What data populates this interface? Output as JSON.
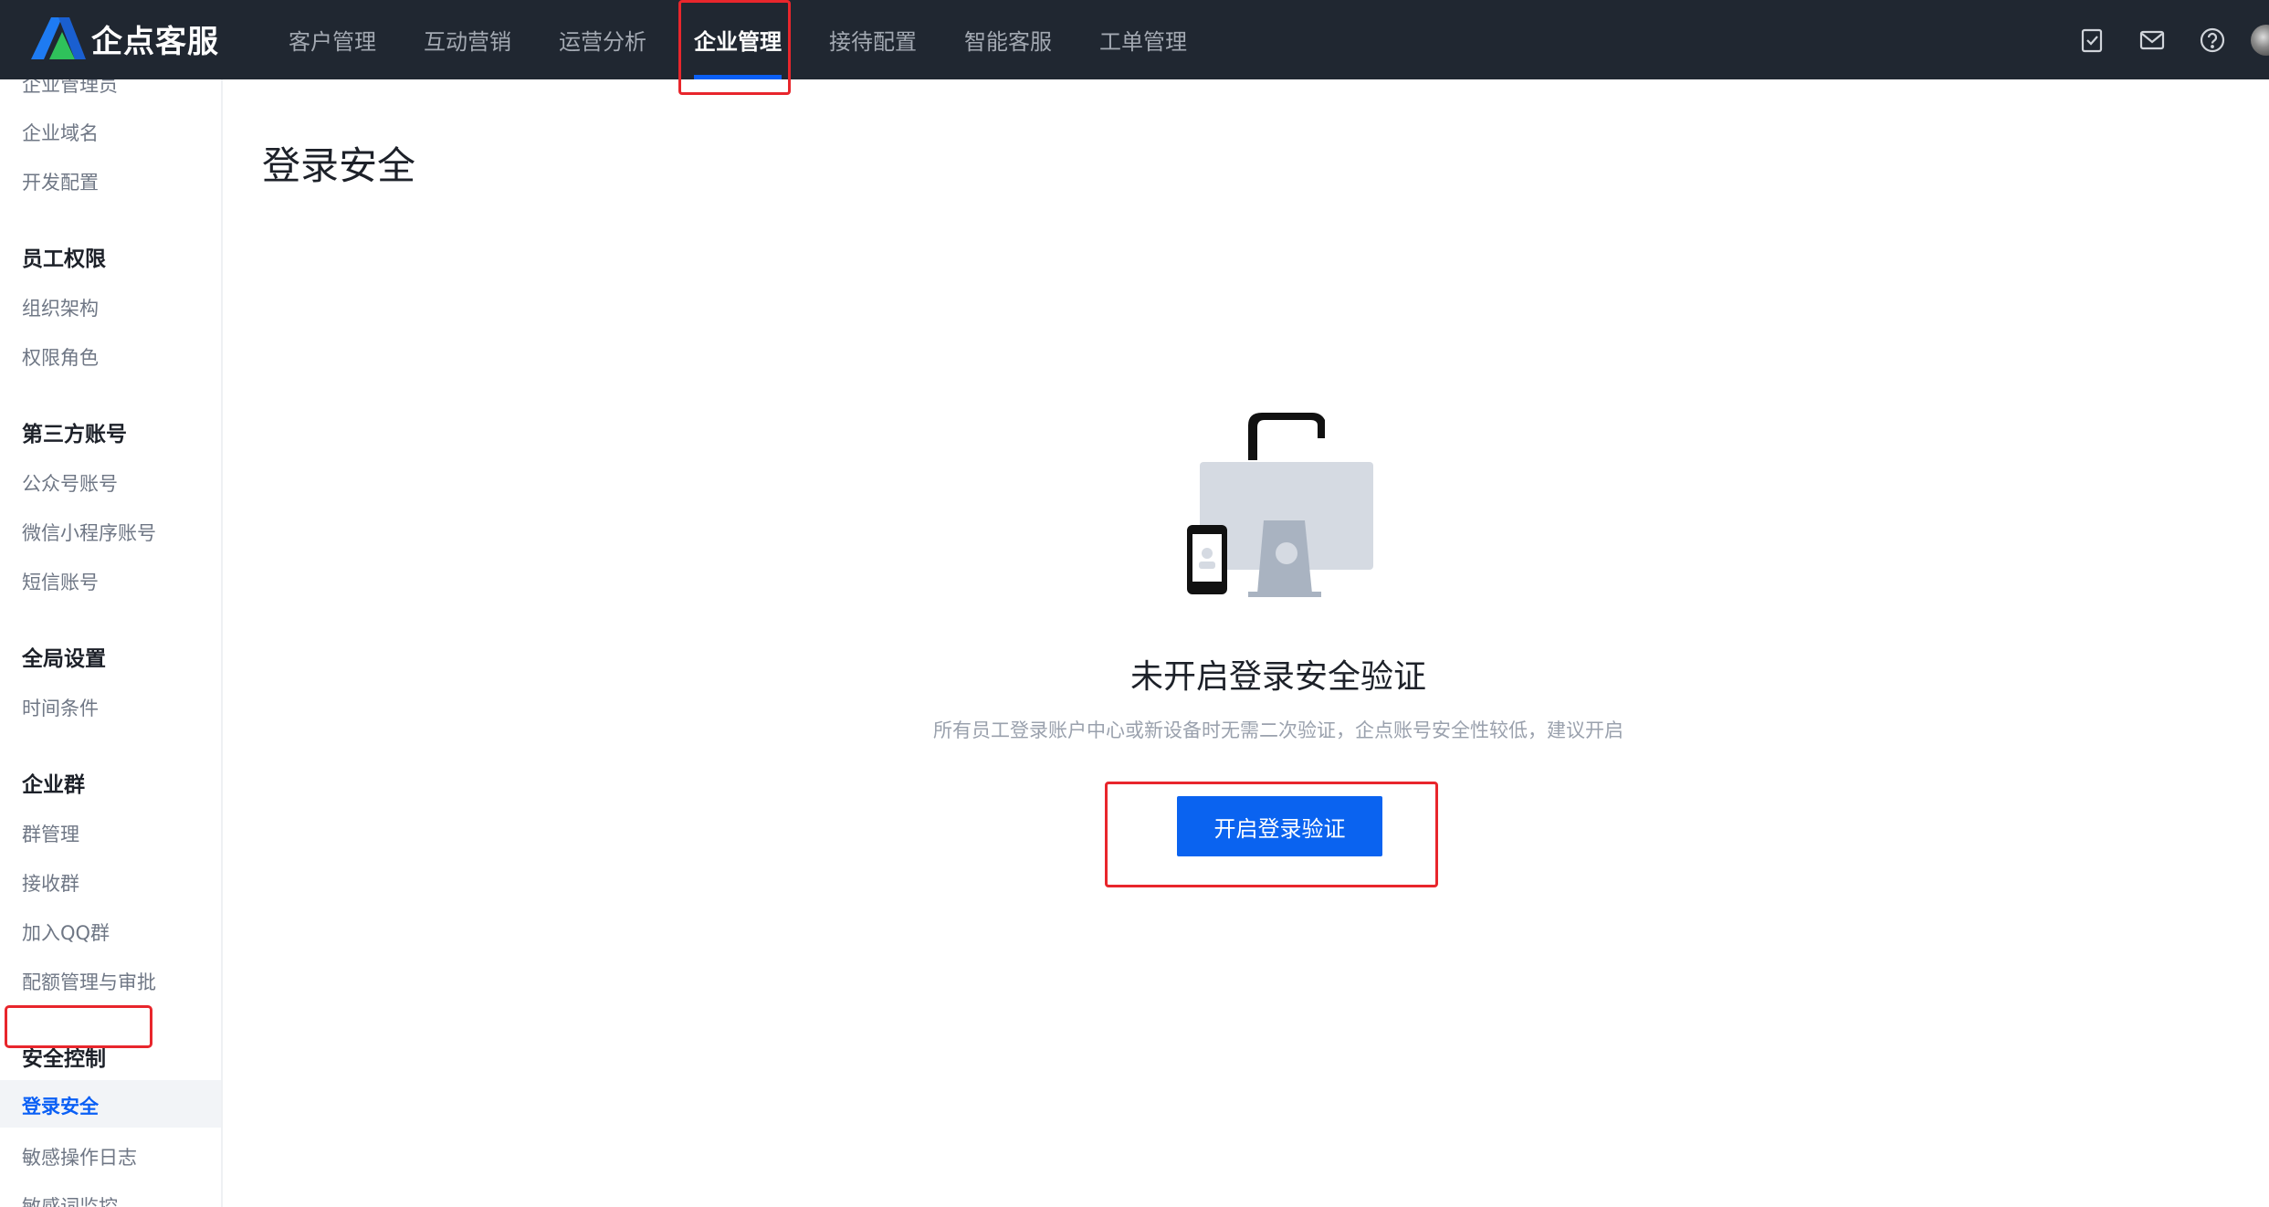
{
  "app": {
    "logo_text": "企点客服"
  },
  "nav": {
    "items": [
      {
        "label": "客户管理"
      },
      {
        "label": "互动营销"
      },
      {
        "label": "运营分析"
      },
      {
        "label": "企业管理",
        "active": true
      },
      {
        "label": "接待配置"
      },
      {
        "label": "智能客服"
      },
      {
        "label": "工单管理"
      }
    ],
    "icons": [
      "checklist-icon",
      "mail-icon",
      "help-icon",
      "avatar"
    ]
  },
  "sidebar": {
    "items": [
      {
        "type": "item",
        "label": "企业管理员"
      },
      {
        "type": "item",
        "label": "企业域名"
      },
      {
        "type": "item",
        "label": "开发配置"
      },
      {
        "type": "group",
        "label": "员工权限"
      },
      {
        "type": "item",
        "label": "组织架构"
      },
      {
        "type": "item",
        "label": "权限角色"
      },
      {
        "type": "group",
        "label": "第三方账号"
      },
      {
        "type": "item",
        "label": "公众号账号"
      },
      {
        "type": "item",
        "label": "微信小程序账号"
      },
      {
        "type": "item",
        "label": "短信账号"
      },
      {
        "type": "group",
        "label": "全局设置"
      },
      {
        "type": "item",
        "label": "时间条件"
      },
      {
        "type": "group",
        "label": "企业群"
      },
      {
        "type": "item",
        "label": "群管理"
      },
      {
        "type": "item",
        "label": "接收群"
      },
      {
        "type": "item",
        "label": "加入QQ群"
      },
      {
        "type": "item",
        "label": "配额管理与审批"
      },
      {
        "type": "group",
        "label": "安全控制"
      },
      {
        "type": "item",
        "label": "登录安全",
        "active": true
      },
      {
        "type": "item",
        "label": "敏感操作日志"
      },
      {
        "type": "item",
        "label": "敏感词监控"
      }
    ]
  },
  "main": {
    "title": "登录安全",
    "empty_state": {
      "title": "未开启登录安全验证",
      "description": "所有员工登录账户中心或新设备时无需二次验证，企点账号安全性较低，建议开启",
      "button_label": "开启登录验证"
    }
  },
  "colors": {
    "topbar": "#202731",
    "accent": "#0a63f0",
    "highlight": "#e8262c"
  }
}
